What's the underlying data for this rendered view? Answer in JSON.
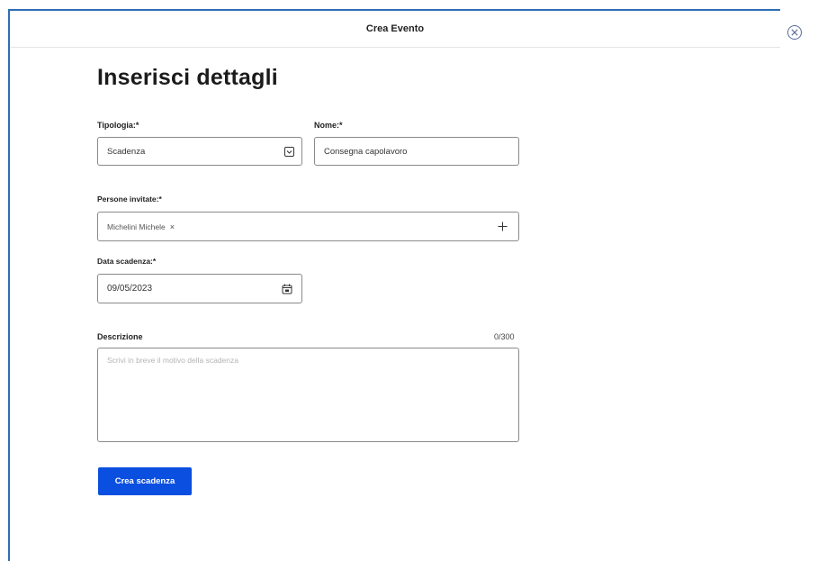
{
  "header": {
    "title": "Crea Evento"
  },
  "form": {
    "title": "Inserisci dettagli",
    "tipologia": {
      "label": "Tipologia:*",
      "value": "Scadenza"
    },
    "nome": {
      "label": "Nome:*",
      "value": "Consegna capolavoro"
    },
    "persone": {
      "label": "Persone invitate:*",
      "chips": [
        {
          "label": "Michelini Michele",
          "remove": "×"
        }
      ],
      "add": "+"
    },
    "data": {
      "label": "Data scadenza:*",
      "value": "09/05/2023"
    },
    "descrizione": {
      "label": "Descrizione",
      "counter": "0/300",
      "placeholder": "Scrivi in breve il motivo della scadenza"
    },
    "submit_label": "Crea scadenza"
  },
  "icons": {
    "close": "close-icon",
    "dropdown": "chevron-down-icon",
    "calendar": "calendar-icon",
    "add": "plus-icon"
  },
  "colors": {
    "accent": "#0b4fe0",
    "frame": "#2e6db4"
  }
}
